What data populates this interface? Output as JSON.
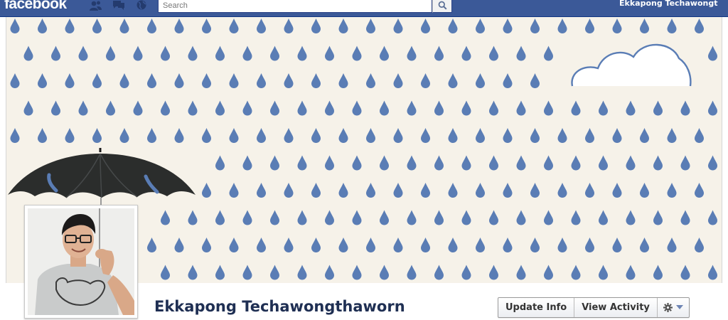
{
  "topbar": {
    "logo": "facebook",
    "search": {
      "placeholder": "Search"
    },
    "user_name": "Ekkapong Techawongt"
  },
  "profile": {
    "name": "Ekkapong Techawongthaworn"
  },
  "actions": {
    "update_info": "Update Info",
    "view_activity": "View Activity"
  },
  "icons": {
    "topbar": [
      "friend-requests-icon",
      "messages-icon",
      "notifications-globe-icon",
      "search-magnifier-icon"
    ],
    "actions": [
      "gear-icon",
      "caret-down-icon"
    ]
  },
  "colors": {
    "brand_blue": "#3b5998",
    "cover_background": "#f6f2e9",
    "raindrop": "#5a7db5",
    "name_text": "#1f2f53"
  }
}
